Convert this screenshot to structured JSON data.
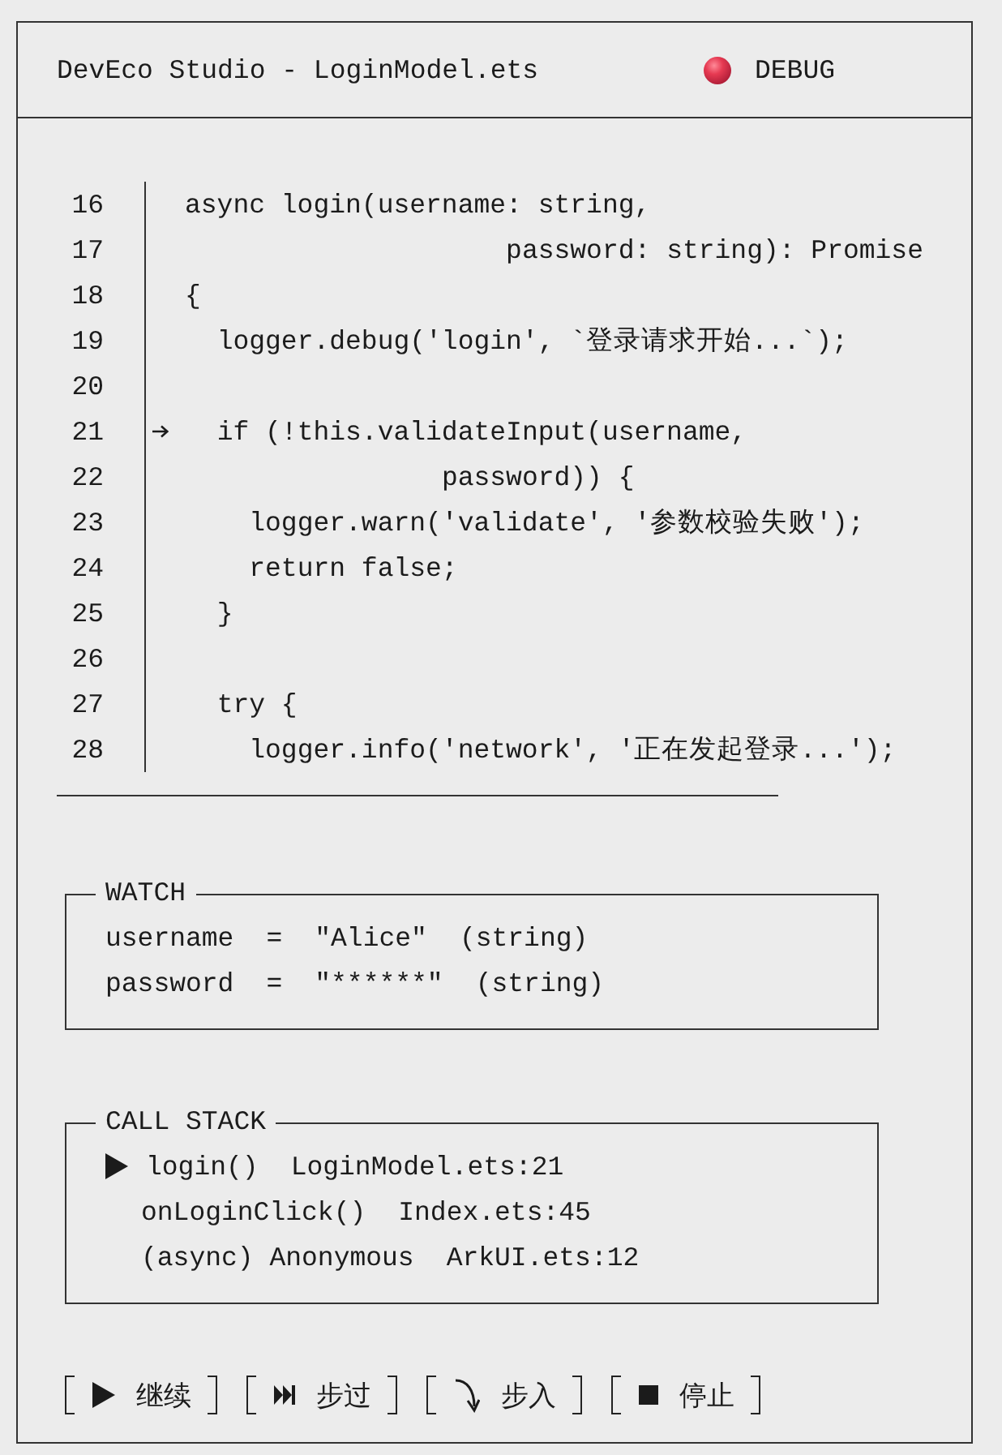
{
  "window": {
    "title": "DevEco Studio - LoginModel.ets",
    "mode": "DEBUG"
  },
  "editor": {
    "lines": [
      {
        "number": "16",
        "code": "async login(username: string,",
        "current": false
      },
      {
        "number": "17",
        "code": "                    password: string): Promise",
        "current": false
      },
      {
        "number": "18",
        "code": "{",
        "current": false
      },
      {
        "number": "19",
        "code": "  logger.debug('login', `登录请求开始...`);",
        "current": false
      },
      {
        "number": "20",
        "current": false
      },
      {
        "number": "21",
        "code": "  if (!this.validateInput(username,",
        "current": true
      },
      {
        "number": "22",
        "code": "                password)) {",
        "current": false
      },
      {
        "number": "23",
        "code": "    logger.warn('validate', '参数校验失败');",
        "current": false
      },
      {
        "number": "24",
        "code": "    return false;",
        "current": false
      },
      {
        "number": "25",
        "code": "  }",
        "current": false
      },
      {
        "number": "26",
        "current": false
      },
      {
        "number": "27",
        "code": "  try {",
        "current": false
      },
      {
        "number": "28",
        "code": "    logger.info('network', '正在发起登录...');",
        "current": false
      }
    ]
  },
  "watch": {
    "title": "WATCH",
    "variables": [
      {
        "name": "username",
        "operator": "=",
        "value": "\"Alice\"",
        "type": "(string)"
      },
      {
        "name": "password",
        "operator": "=",
        "value": "\"******\"",
        "type": "(string)"
      }
    ]
  },
  "call_stack": {
    "title": "CALL STACK",
    "frames": [
      {
        "function": "login()",
        "location": "LoginModel.ets:21",
        "selected": true
      },
      {
        "function": "onLoginClick()",
        "location": "Index.ets:45",
        "selected": false
      },
      {
        "function": "(async) Anonymous",
        "location": "ArkUI.ets:12",
        "selected": false
      }
    ]
  },
  "toolbar": {
    "buttons": [
      {
        "kind": "continue",
        "label": "继续"
      },
      {
        "kind": "step_over",
        "label": "步过"
      },
      {
        "kind": "step_into",
        "label": "步入"
      },
      {
        "kind": "stop",
        "label": "停止"
      }
    ]
  }
}
